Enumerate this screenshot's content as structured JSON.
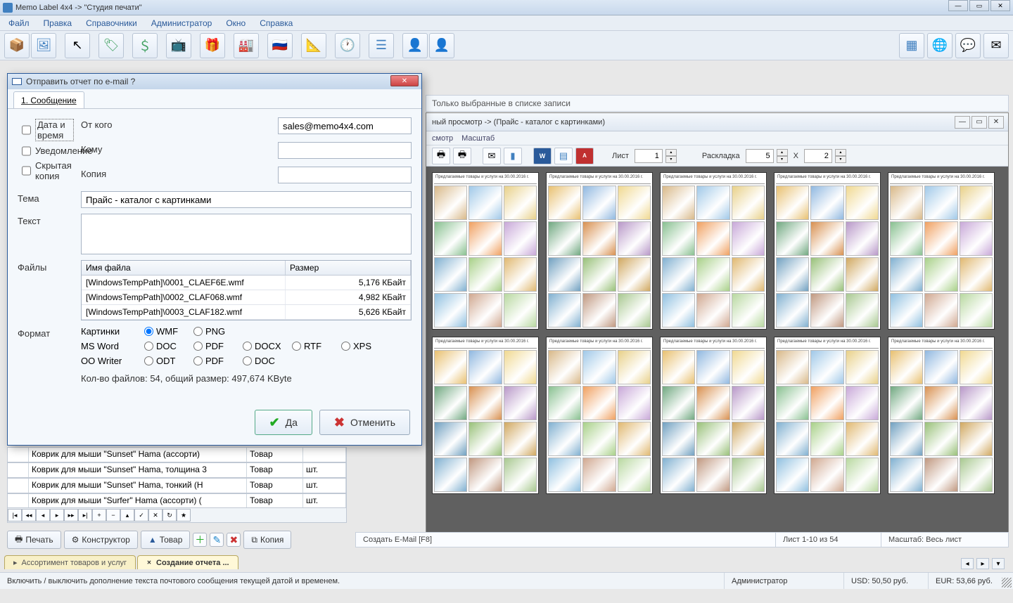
{
  "title": "Memo Label 4x4 -> \"Студия печати\"",
  "menu": {
    "file": "Файл",
    "edit": "Правка",
    "ref": "Справочники",
    "admin": "Администратор",
    "window": "Окно",
    "help": "Справка"
  },
  "filter_checkbox_label": "Только выбранные в списке записи",
  "preview": {
    "title": "ный просмотр -> (Прайс - каталог с картинками)",
    "menu_view": "смотр",
    "menu_scale": "Масштаб",
    "sheet_label": "Лист",
    "sheet_value": "1",
    "layout_label": "Раскладка",
    "layout_cols": "5",
    "layout_x": "X",
    "layout_rows": "2",
    "page_header": "Предлагаемые товары и услуги на 30.00.2016 г."
  },
  "right_status": {
    "hint": "Создать E-Mail [F8]",
    "pages": "Лист 1-10 из 54",
    "scale": "Масштаб: Весь лист"
  },
  "left_buttons": {
    "print": "Печать",
    "designer": "Конструктор",
    "tovar": "Товар",
    "copy": "Копия"
  },
  "bottom_tabs": {
    "tab1": "Ассортимент товаров и услуг",
    "tab2": "Создание отчета ..."
  },
  "statusbar": {
    "hint": "Включить / выключить дополнение текста почтового сообщения текущей датой и временем.",
    "admin": "Администратор",
    "usd": "USD: 50,50 руб.",
    "eur": "EUR: 53,66 руб."
  },
  "data_rows": [
    {
      "name": "Коврик для мыши \"Sunset\" Hama (ассорти)",
      "type": "Товар",
      "unit": ""
    },
    {
      "name": "Коврик для мыши \"Sunset\" Hama, толщина 3",
      "type": "Товар",
      "unit": "шт."
    },
    {
      "name": "Коврик для мыши \"Sunset\" Hama, тонкий (Н",
      "type": "Товар",
      "unit": "шт."
    },
    {
      "name": "Коврик для мыши \"Surfer\" Hama (ассорти) (",
      "type": "Товар",
      "unit": "шт."
    }
  ],
  "dialog": {
    "title": " Отправить отчет по e-mail ?",
    "tab": "1. Сообщение",
    "lbl_from": "От кого",
    "lbl_to": "Кому",
    "lbl_cc": "Копия",
    "lbl_subj": "Тема",
    "lbl_body": "Текст",
    "lbl_files": "Файлы",
    "lbl_fmt": "Формат",
    "from": "sales@memo4x4.com",
    "to": "",
    "cc": "",
    "subject": "Прайс - каталог с картинками",
    "body": "",
    "chk_date": "Дата и время",
    "chk_notify": "Уведомление",
    "chk_bcc": "Скрытая копия",
    "files_header_name": "Имя файла",
    "files_header_size": "Размер",
    "files": [
      {
        "name": "[WindowsTempPath]\\0001_CLAEF6E.wmf",
        "size": "5,176 КБайт"
      },
      {
        "name": "[WindowsTempPath]\\0002_CLAF068.wmf",
        "size": "4,982 КБайт"
      },
      {
        "name": "[WindowsTempPath]\\0003_CLAF182.wmf",
        "size": "5,626 КБайт"
      }
    ],
    "fmt_row1_label": "Картинки",
    "fmt_wmf": "WMF",
    "fmt_png": "PNG",
    "fmt_row2_label": "MS Word",
    "fmt_doc": "DOC",
    "fmt_pdf": "PDF",
    "fmt_docx": "DOCX",
    "fmt_rtf": "RTF",
    "fmt_xps": "XPS",
    "fmt_row3_label": "OO Writer",
    "fmt_odt": "ODT",
    "fmt_pdf2": "PDF",
    "fmt_doc2": "DOC",
    "summary": "Кол-во файлов: 54, общий размер: 497,674 KByte",
    "btn_yes": "Да",
    "btn_cancel": "Отменить"
  }
}
